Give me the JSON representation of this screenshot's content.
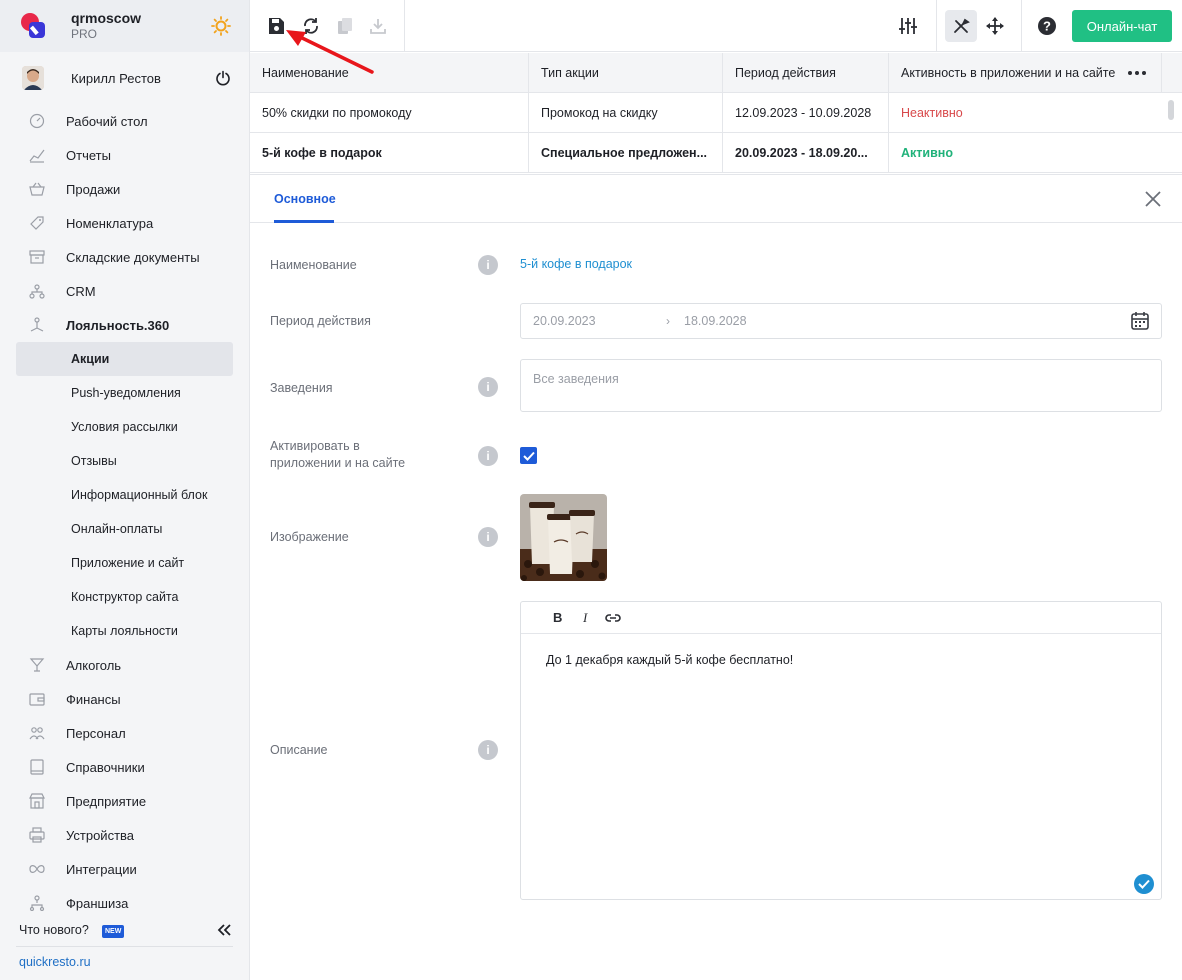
{
  "brand": {
    "name": "qrmoscow",
    "plan": "PRO"
  },
  "user": {
    "name": "Кирилл Рестов"
  },
  "sidebar": {
    "items_top": [
      {
        "label": "Рабочий стол",
        "icon": "dashboard-icon"
      },
      {
        "label": "Отчеты",
        "icon": "chart-icon"
      },
      {
        "label": "Продажи",
        "icon": "basket-icon"
      },
      {
        "label": "Номенклатура",
        "icon": "tag-icon"
      },
      {
        "label": "Складские документы",
        "icon": "archive-icon"
      },
      {
        "label": "CRM",
        "icon": "crm-icon"
      },
      {
        "label": "Лояльность.360",
        "icon": "loyalty-icon"
      }
    ],
    "sub_items": [
      {
        "label": "Акции",
        "active": true
      },
      {
        "label": "Push-уведомления"
      },
      {
        "label": "Условия рассылки"
      },
      {
        "label": "Отзывы"
      },
      {
        "label": "Информационный блок"
      },
      {
        "label": "Онлайн-оплаты"
      },
      {
        "label": "Приложение и сайт"
      },
      {
        "label": "Конструктор сайта"
      },
      {
        "label": "Карты лояльности"
      }
    ],
    "items_bottom": [
      {
        "label": "Алкоголь",
        "icon": "glass-icon"
      },
      {
        "label": "Финансы",
        "icon": "wallet-icon"
      },
      {
        "label": "Персонал",
        "icon": "people-icon"
      },
      {
        "label": "Справочники",
        "icon": "book-icon"
      },
      {
        "label": "Предприятие",
        "icon": "store-icon"
      },
      {
        "label": "Устройства",
        "icon": "printer-icon"
      },
      {
        "label": "Интеграции",
        "icon": "infinity-icon"
      },
      {
        "label": "Франшиза",
        "icon": "franchise-icon"
      }
    ],
    "whats_new": "Что нового?",
    "new_badge": "NEW",
    "site_link": "quickresto.ru"
  },
  "toolbar": {
    "chat_label": "Онлайн-чат"
  },
  "table": {
    "headers": [
      "Наименование",
      "Тип акции",
      "Период действия",
      "Активность в приложении и на сайте"
    ],
    "rows": [
      {
        "name": "50% скидки по промокоду",
        "type": "Промокод на скидку",
        "period": "12.09.2023 - 10.09.2028",
        "status": "Неактивно"
      },
      {
        "name": "5-й кофе в подарок",
        "type": "Специальное предложен...",
        "period": "20.09.2023 - 18.09.20...",
        "status": "Активно"
      }
    ]
  },
  "form": {
    "tab": "Основное",
    "labels": {
      "name": "Наименование",
      "period": "Период действия",
      "venues": "Заведения",
      "activate": "Активировать в приложении и на сайте",
      "image": "Изображение",
      "description": "Описание"
    },
    "name_value": "5-й кофе в подарок",
    "date_from": "20.09.2023",
    "date_to": "18.09.2028",
    "venues_placeholder": "Все заведения",
    "activate_checked": true,
    "editor": {
      "bold": "B",
      "italic": "I",
      "text": "До 1 декабря каждый 5-й кофе бесплатно!"
    }
  },
  "colors": {
    "accent": "#1e5bd8",
    "chat": "#20c084",
    "inactive": "#d8494b",
    "active": "#20b27a",
    "link": "#1f8fd1"
  }
}
